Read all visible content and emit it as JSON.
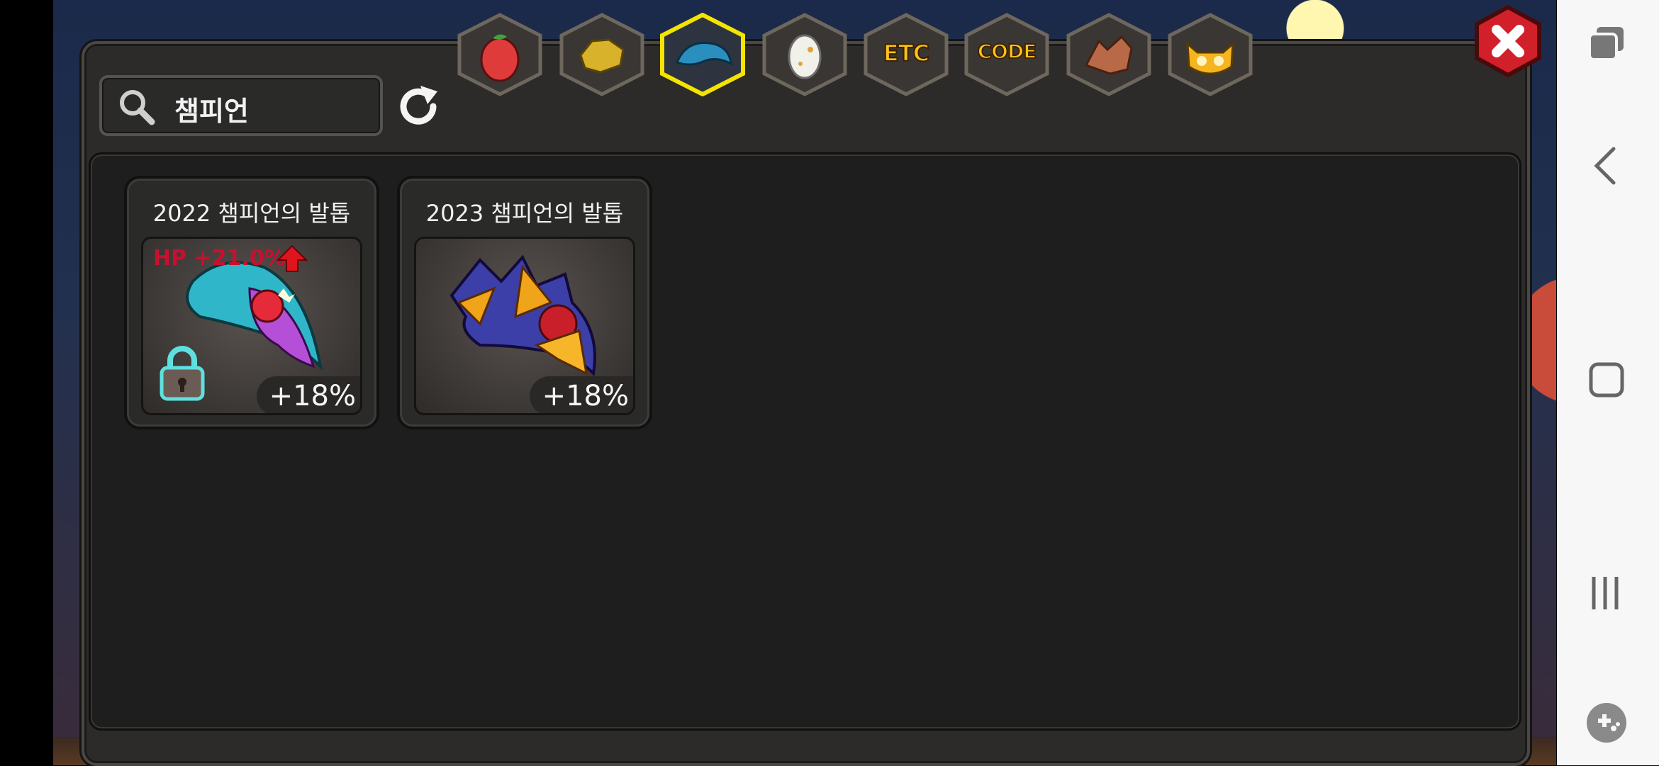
{
  "search": {
    "value": "챔피언"
  },
  "tabs": [
    {
      "name": "fruit",
      "label": ""
    },
    {
      "name": "gold",
      "label": ""
    },
    {
      "name": "claw",
      "label": "",
      "selected": true
    },
    {
      "name": "egg",
      "label": ""
    },
    {
      "name": "etc",
      "label": "ETC"
    },
    {
      "name": "code",
      "label": "CODE"
    },
    {
      "name": "dragon",
      "label": ""
    },
    {
      "name": "mask",
      "label": ""
    }
  ],
  "cards": [
    {
      "title": "2022 챔피언의 발톱",
      "percent": "+18%",
      "hp_bonus": "HP +21.0%",
      "locked": true
    },
    {
      "title": "2023 챔피언의 발톱",
      "percent": "+18%"
    }
  ],
  "colors": {
    "accent": "#ffc21a",
    "selected_border": "#f5e400",
    "close_red": "#d1202a"
  }
}
